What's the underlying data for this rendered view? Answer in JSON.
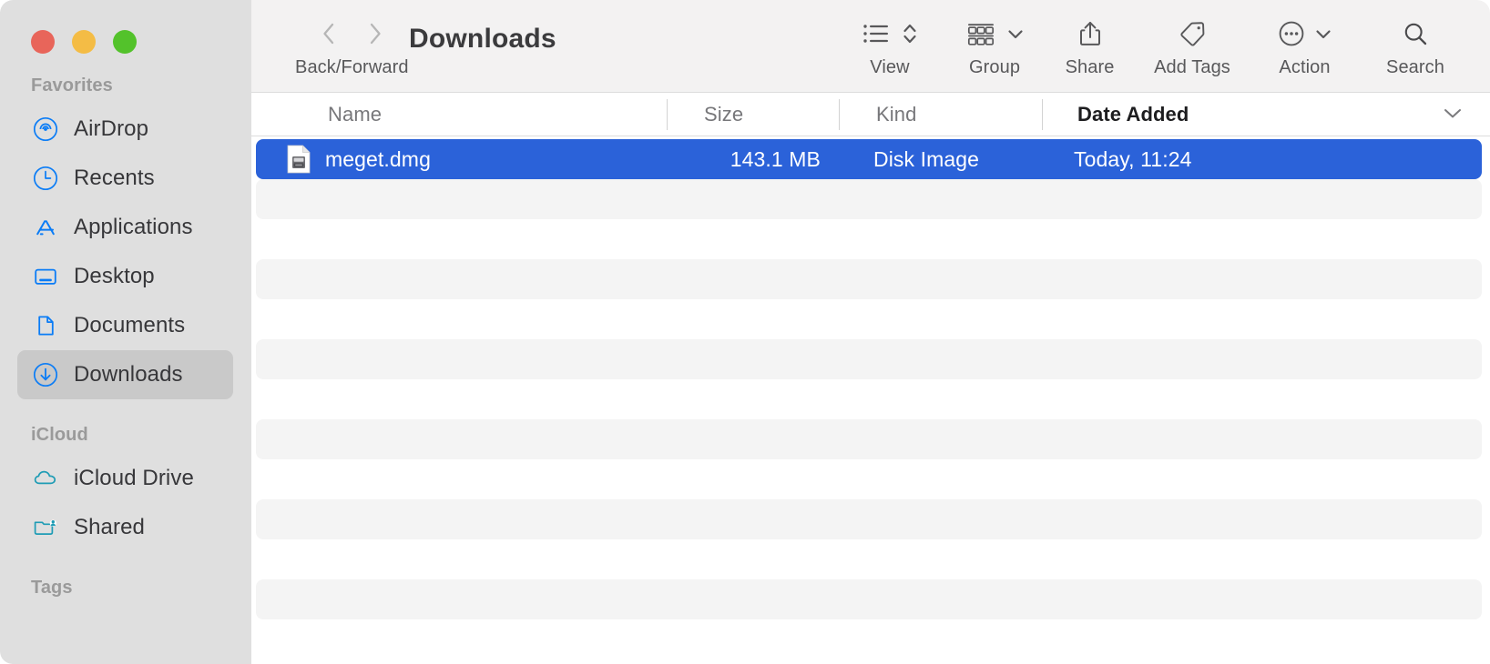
{
  "window": {
    "title": "Downloads",
    "traffic_lights": [
      {
        "name": "close",
        "color": "#e8655a"
      },
      {
        "name": "minimize",
        "color": "#f4bc45"
      },
      {
        "name": "maximize",
        "color": "#53c22b"
      }
    ]
  },
  "sidebar": {
    "sections": [
      {
        "title": "Favorites",
        "items": [
          {
            "label": "AirDrop",
            "icon": "airdrop-icon",
            "selected": false
          },
          {
            "label": "Recents",
            "icon": "clock-icon",
            "selected": false
          },
          {
            "label": "Applications",
            "icon": "applications-icon",
            "selected": false
          },
          {
            "label": "Desktop",
            "icon": "desktop-icon",
            "selected": false
          },
          {
            "label": "Documents",
            "icon": "document-icon",
            "selected": false
          },
          {
            "label": "Downloads",
            "icon": "downloads-icon",
            "selected": true
          }
        ]
      },
      {
        "title": "iCloud",
        "items": [
          {
            "label": "iCloud Drive",
            "icon": "cloud-icon",
            "selected": false
          },
          {
            "label": "Shared",
            "icon": "shared-folder-icon",
            "selected": false
          }
        ]
      },
      {
        "title": "Tags",
        "items": []
      }
    ]
  },
  "toolbar": {
    "back_forward": {
      "caption": "Back/Forward",
      "back_icon": "chevron-left-icon",
      "forward_icon": "chevron-right-icon"
    },
    "buttons": [
      {
        "caption": "View",
        "icon": "list-view-icon",
        "has_chevron": false,
        "has_stepper": true
      },
      {
        "caption": "Group",
        "icon": "group-icon",
        "has_chevron": true,
        "has_stepper": false
      },
      {
        "caption": "Share",
        "icon": "share-icon",
        "has_chevron": false,
        "has_stepper": false
      },
      {
        "caption": "Add Tags",
        "icon": "tag-icon",
        "has_chevron": false,
        "has_stepper": false
      },
      {
        "caption": "Action",
        "icon": "ellipsis-circle-icon",
        "has_chevron": true,
        "has_stepper": false
      },
      {
        "caption": "Search",
        "icon": "search-icon",
        "has_chevron": false,
        "has_stepper": false
      }
    ]
  },
  "columns": [
    {
      "label": "Name",
      "sorted": false
    },
    {
      "label": "Size",
      "sorted": false
    },
    {
      "label": "Kind",
      "sorted": false
    },
    {
      "label": "Date Added",
      "sorted": true,
      "sort_icon": "chevron-down-icon"
    }
  ],
  "files": [
    {
      "name": "meget.dmg",
      "size": "143.1 MB",
      "kind": "Disk Image",
      "date_added": "Today, 11:24",
      "icon": "disk-image-file-icon",
      "selected": true
    }
  ],
  "colors": {
    "selection_blue": "#2b62d9",
    "sidebar_background": "#dfdfdf",
    "sidebar_selected": "#c9c9c9",
    "toolbar_background": "#f3f2f2",
    "row_stripe": "#f4f4f4",
    "accent_icon_blue": "#0a7cf6",
    "icloud_teal": "#1f9cb5"
  },
  "empty_row_count": 6
}
